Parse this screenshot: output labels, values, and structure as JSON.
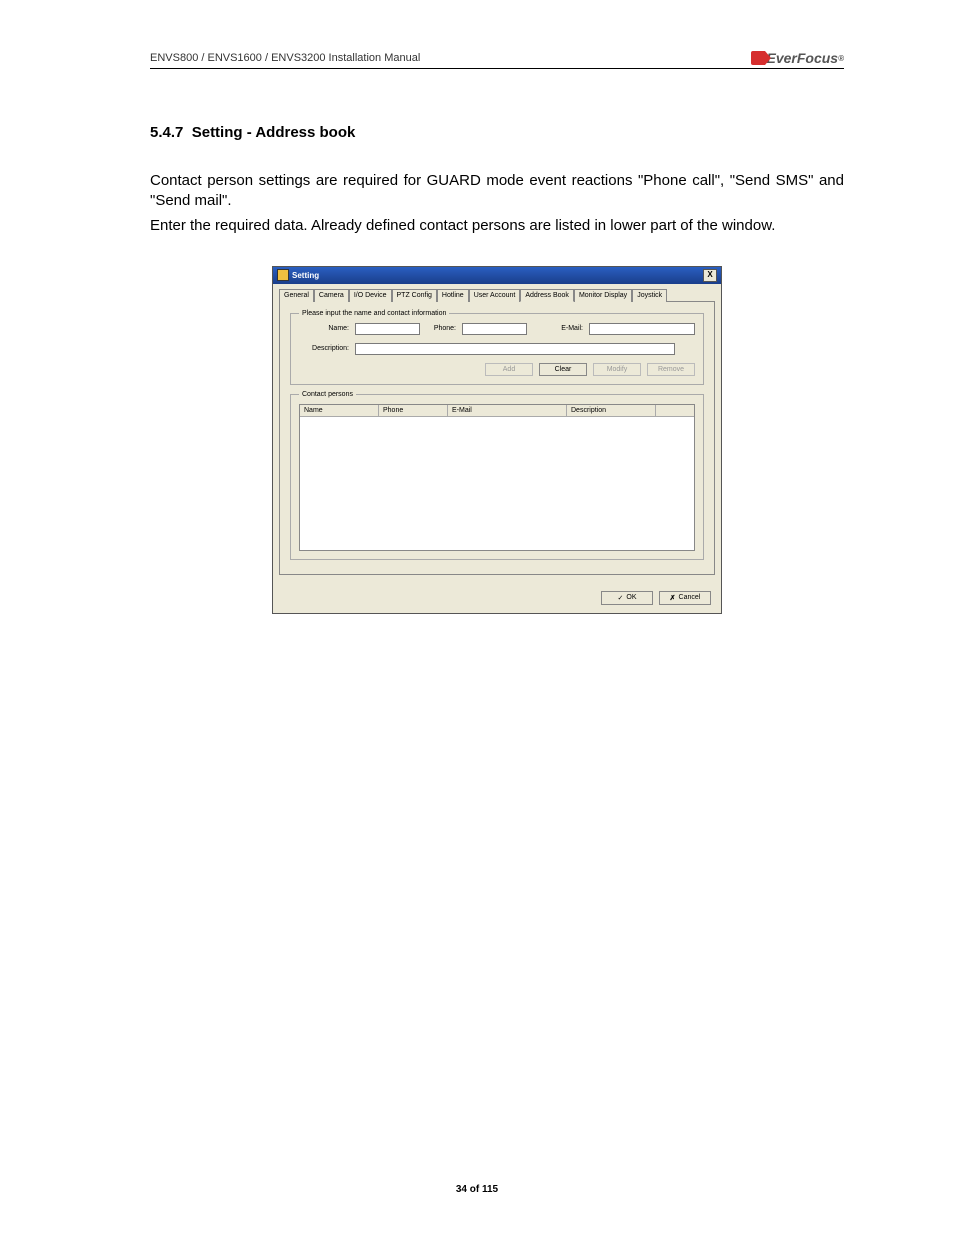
{
  "header": {
    "doc_title": "ENVS800 / ENVS1600 / ENVS3200 Installation Manual",
    "brand": "EverFocus",
    "brand_suffix": "®"
  },
  "section": {
    "number": "5.4.7",
    "title": "Setting - Address book"
  },
  "paragraphs": {
    "p1": "Contact person settings are required for GUARD mode event reactions \"Phone call\", \"Send SMS\" and  \"Send mail\".",
    "p2": "Enter the required data. Already defined contact persons are listed in lower part of the window."
  },
  "dialog": {
    "title": "Setting",
    "close_glyph": "X",
    "tabs": [
      "General",
      "Camera",
      "I/O Device",
      "PTZ Config",
      "Hotline",
      "User Account",
      "Address Book",
      "Monitor Display",
      "Joystick"
    ],
    "active_tab": "Address Book",
    "fieldset_legend": "Please input the name and contact information",
    "labels": {
      "name": "Name:",
      "phone": "Phone:",
      "email": "E-Mail:",
      "description": "Description:"
    },
    "buttons": {
      "add": "Add",
      "clear": "Clear",
      "modify": "Modify",
      "remove": "Remove"
    },
    "list_legend": "Contact persons",
    "columns": {
      "name": "Name",
      "phone": "Phone",
      "email": "E-Mail",
      "description": "Description"
    },
    "footer": {
      "ok": "OK",
      "cancel": "Cancel",
      "ok_glyph": "✓",
      "cancel_glyph": "✗"
    }
  },
  "page_number": "34 of 115"
}
